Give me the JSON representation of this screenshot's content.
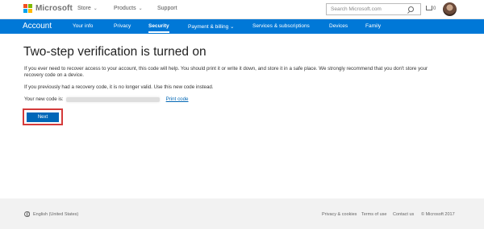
{
  "header": {
    "brand": "Microsoft",
    "nav": [
      {
        "label": "Store",
        "has_dropdown": true
      },
      {
        "label": "Products",
        "has_dropdown": true
      },
      {
        "label": "Support",
        "has_dropdown": false
      }
    ],
    "search_placeholder": "Search Microsoft.com",
    "cart_count": "0",
    "logo_colors": [
      "#f25022",
      "#7fba00",
      "#00a4ef",
      "#ffb900"
    ]
  },
  "account_nav": {
    "title": "Account",
    "items": [
      {
        "label": "Your info",
        "active": false
      },
      {
        "label": "Privacy",
        "active": false
      },
      {
        "label": "Security",
        "active": true
      },
      {
        "label": "Payment & billing",
        "active": false,
        "has_dropdown": true
      },
      {
        "label": "Services & subscriptions",
        "active": false
      },
      {
        "label": "Devices",
        "active": false
      },
      {
        "label": "Family",
        "active": false
      }
    ],
    "accent": "#0078d7"
  },
  "main": {
    "title": "Two-step verification is turned on",
    "paragraph1_line1": "If you ever need to recover access to your account, this code will help. You should print it or write it down, and store it in a safe place. We strongly recommend that you don't store your",
    "paragraph1_line2": "recovery code on a device.",
    "paragraph2": "If you previously had a recovery code, it is no longer valid. Use this new code instead.",
    "code_label": "Your new code is:",
    "print_link": "Print code",
    "next_button": "Next",
    "highlight_color": "#d43a3a"
  },
  "footer": {
    "language": "English (United States)",
    "links": [
      "Privacy & cookies",
      "Terms of use",
      "Contact us",
      "© Microsoft 2017"
    ]
  }
}
